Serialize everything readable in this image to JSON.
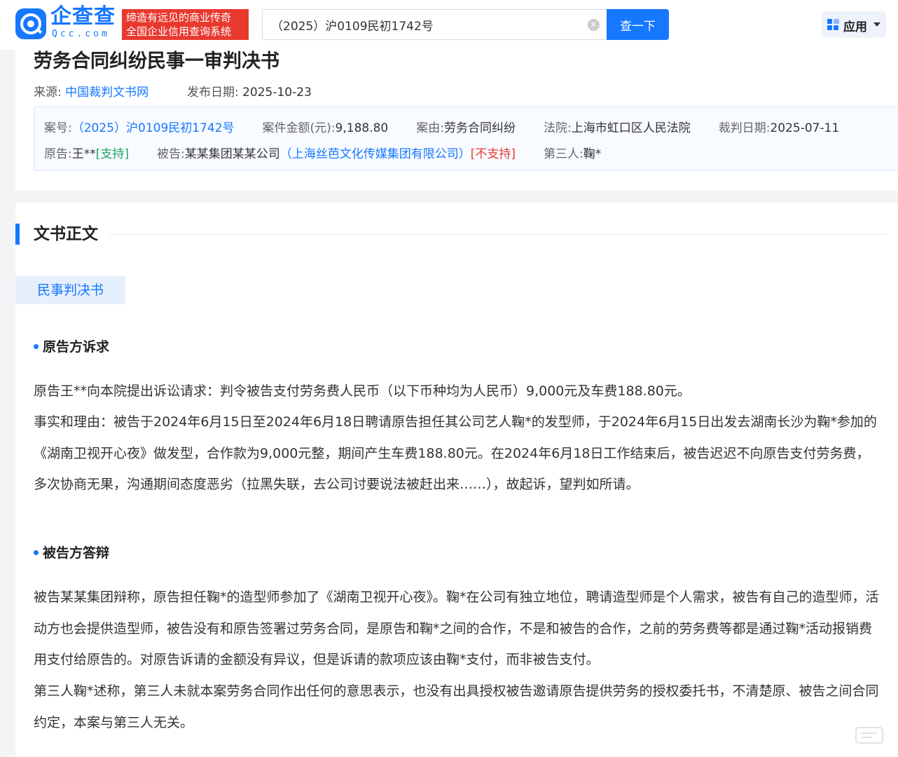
{
  "header": {
    "logo_text": "企查查",
    "logo_domain": "Qcc.com",
    "slogan_line1": "缔造有远见的商业传奇",
    "slogan_line2": "全国企业信用查询系统",
    "search_value": "（2025）沪0109民初1742号",
    "search_button": "查一下",
    "apps_label": "应用",
    "brand_color": "#1677ff"
  },
  "document": {
    "title": "劳务合同纠纷民事一审判决书",
    "source_label": "来源:",
    "source_value": "中国裁判文书网",
    "publish_label": "发布日期:",
    "publish_value": "2025-10-23"
  },
  "case_info": {
    "case_no_label": "案号:",
    "case_no_value": "（2025）沪0109民初1742号",
    "amount_label": "案件金额(元):",
    "amount_value": "9,188.80",
    "cause_label": "案由:",
    "cause_value": "劳务合同纠纷",
    "court_label": "法院:",
    "court_value": "上海市虹口区人民法院",
    "date_label": "裁判日期:",
    "date_value": "2025-07-11",
    "plaintiff_label": "原告:",
    "plaintiff_value": "王**",
    "plaintiff_status": "[支持]",
    "defendant_label": "被告:",
    "defendant_value": "某某集团某某公司",
    "defendant_company": "（上海丝芭文化传媒集团有限公司）",
    "defendant_status": "[不支持]",
    "third_label": "第三人:",
    "third_value": "鞠*"
  },
  "body": {
    "section_title": "文书正文",
    "doc_tab": "民事判决书",
    "plaintiff_heading": "原告方诉求",
    "plaintiff_p1": "原告王**向本院提出诉讼请求：判令被告支付劳务费人民币（以下币种均为人民币）9,000元及车费188.80元。",
    "plaintiff_p2": "事实和理由：被告于2024年6月15日至2024年6月18日聘请原告担任其公司艺人鞠*的发型师，于2024年6月15日出发去湖南长沙为鞠*参加的《湖南卫视开心夜》做发型，合作款为9,000元整，期间产生车费188.80元。在2024年6月18日工作结束后，被告迟迟不向原告支付劳务费，多次协商无果，沟通期间态度恶劣（拉黑失联，去公司讨要说法被赶出来……），故起诉，望判如所请。",
    "defendant_heading": "被告方答辩",
    "defendant_p1": "被告某某集团辩称，原告担任鞠*的造型师参加了《湖南卫视开心夜》。鞠*在公司有独立地位，聘请造型师是个人需求，被告有自己的造型师，活动方也会提供造型师，被告没有和原告签署过劳务合同，是原告和鞠*之间的合作，不是和被告的合作，之前的劳务费等都是通过鞠*活动报销费用支付给原告的。对原告诉请的金额没有异议，但是诉请的款项应该由鞠*支付，而非被告支付。",
    "defendant_p2": "第三人鞠*述称，第三人未就本案劳务合同作出任何的意思表示，也没有出具授权被告邀请原告提供劳务的授权委托书，不清楚原、被告之间合同约定，本案与第三人无关。"
  }
}
